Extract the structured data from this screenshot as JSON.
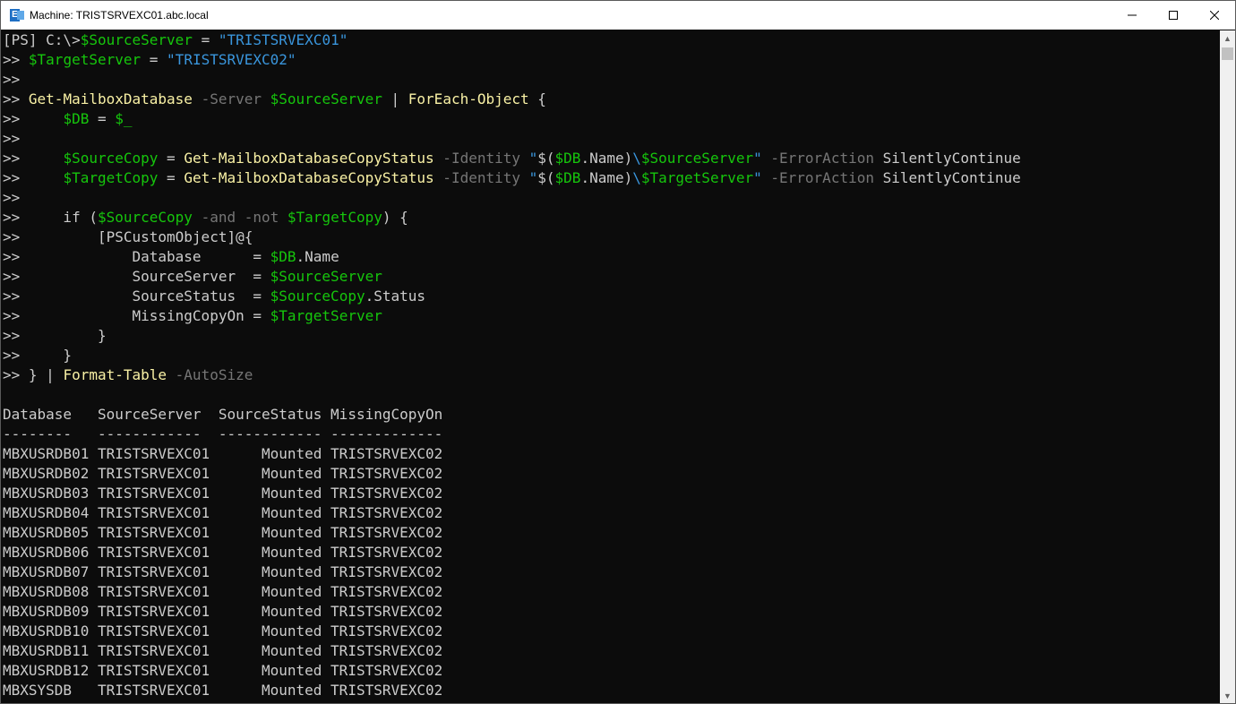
{
  "window": {
    "title": "Machine: TRISTSRVEXC01.abc.local",
    "icon": "exchange-management-shell-icon",
    "controls": [
      "minimize-icon",
      "maximize-icon",
      "close-icon"
    ]
  },
  "colors": {
    "background": "#0c0c0c",
    "default_text": "#cccccc",
    "command": "#f9f1a5",
    "variable": "#16c60c",
    "string": "#3a96dd",
    "parameter": "#767676"
  },
  "console": {
    "lines": [
      [
        {
          "t": "[PS] C:\\>",
          "c": "c-plain"
        },
        {
          "t": "$SourceServer",
          "c": "c-var"
        },
        {
          "t": " = ",
          "c": "c-plain"
        },
        {
          "t": "\"TRISTSRVEXC01\"",
          "c": "c-str"
        }
      ],
      [
        {
          "t": ">> ",
          "c": "c-plain"
        },
        {
          "t": "$TargetServer",
          "c": "c-var"
        },
        {
          "t": " = ",
          "c": "c-plain"
        },
        {
          "t": "\"TRISTSRVEXC02\"",
          "c": "c-str"
        }
      ],
      [
        {
          "t": ">>",
          "c": "c-plain"
        }
      ],
      [
        {
          "t": ">> ",
          "c": "c-plain"
        },
        {
          "t": "Get-MailboxDatabase",
          "c": "c-cmd"
        },
        {
          "t": " -Server",
          "c": "c-param"
        },
        {
          "t": " ",
          "c": "c-plain"
        },
        {
          "t": "$SourceServer",
          "c": "c-var"
        },
        {
          "t": " | ",
          "c": "c-plain"
        },
        {
          "t": "ForEach-Object",
          "c": "c-cmd"
        },
        {
          "t": " {",
          "c": "c-plain"
        }
      ],
      [
        {
          "t": ">>     ",
          "c": "c-plain"
        },
        {
          "t": "$DB",
          "c": "c-var"
        },
        {
          "t": " = ",
          "c": "c-plain"
        },
        {
          "t": "$_",
          "c": "c-var"
        }
      ],
      [
        {
          "t": ">>",
          "c": "c-plain"
        }
      ],
      [
        {
          "t": ">>     ",
          "c": "c-plain"
        },
        {
          "t": "$SourceCopy",
          "c": "c-var"
        },
        {
          "t": " = ",
          "c": "c-plain"
        },
        {
          "t": "Get-MailboxDatabaseCopyStatus",
          "c": "c-cmd"
        },
        {
          "t": " -Identity",
          "c": "c-param"
        },
        {
          "t": " \"",
          "c": "c-str"
        },
        {
          "t": "$(",
          "c": "c-plain"
        },
        {
          "t": "$DB",
          "c": "c-var"
        },
        {
          "t": ".Name)",
          "c": "c-plain"
        },
        {
          "t": "\\",
          "c": "c-str"
        },
        {
          "t": "$SourceServer",
          "c": "c-var"
        },
        {
          "t": "\"",
          "c": "c-str"
        },
        {
          "t": " -ErrorAction",
          "c": "c-param"
        },
        {
          "t": " SilentlyContinue",
          "c": "c-plain"
        }
      ],
      [
        {
          "t": ">>     ",
          "c": "c-plain"
        },
        {
          "t": "$TargetCopy",
          "c": "c-var"
        },
        {
          "t": " = ",
          "c": "c-plain"
        },
        {
          "t": "Get-MailboxDatabaseCopyStatus",
          "c": "c-cmd"
        },
        {
          "t": " -Identity",
          "c": "c-param"
        },
        {
          "t": " \"",
          "c": "c-str"
        },
        {
          "t": "$(",
          "c": "c-plain"
        },
        {
          "t": "$DB",
          "c": "c-var"
        },
        {
          "t": ".Name)",
          "c": "c-plain"
        },
        {
          "t": "\\",
          "c": "c-str"
        },
        {
          "t": "$TargetServer",
          "c": "c-var"
        },
        {
          "t": "\"",
          "c": "c-str"
        },
        {
          "t": " -ErrorAction",
          "c": "c-param"
        },
        {
          "t": " SilentlyContinue",
          "c": "c-plain"
        }
      ],
      [
        {
          "t": ">>",
          "c": "c-plain"
        }
      ],
      [
        {
          "t": ">>     if (",
          "c": "c-plain"
        },
        {
          "t": "$SourceCopy",
          "c": "c-var"
        },
        {
          "t": " -and -not",
          "c": "c-param"
        },
        {
          "t": " ",
          "c": "c-plain"
        },
        {
          "t": "$TargetCopy",
          "c": "c-var"
        },
        {
          "t": ") {",
          "c": "c-plain"
        }
      ],
      [
        {
          "t": ">>         [PSCustomObject]@{",
          "c": "c-plain"
        }
      ],
      [
        {
          "t": ">>             Database      = ",
          "c": "c-plain"
        },
        {
          "t": "$DB",
          "c": "c-var"
        },
        {
          "t": ".Name",
          "c": "c-plain"
        }
      ],
      [
        {
          "t": ">>             SourceServer  = ",
          "c": "c-plain"
        },
        {
          "t": "$SourceServer",
          "c": "c-var"
        }
      ],
      [
        {
          "t": ">>             SourceStatus  = ",
          "c": "c-plain"
        },
        {
          "t": "$SourceCopy",
          "c": "c-var"
        },
        {
          "t": ".Status",
          "c": "c-plain"
        }
      ],
      [
        {
          "t": ">>             MissingCopyOn = ",
          "c": "c-plain"
        },
        {
          "t": "$TargetServer",
          "c": "c-var"
        }
      ],
      [
        {
          "t": ">>         }",
          "c": "c-plain"
        }
      ],
      [
        {
          "t": ">>     }",
          "c": "c-plain"
        }
      ],
      [
        {
          "t": ">> } | ",
          "c": "c-plain"
        },
        {
          "t": "Format-Table",
          "c": "c-cmd"
        },
        {
          "t": " -AutoSize",
          "c": "c-param"
        }
      ],
      [
        {
          "t": "",
          "c": "c-plain"
        }
      ],
      [
        {
          "t": "Database   SourceServer  SourceStatus MissingCopyOn",
          "c": "c-plain"
        }
      ],
      [
        {
          "t": "--------   ------------  ------------ -------------",
          "c": "c-plain"
        }
      ],
      [
        {
          "t": "MBXUSRDB01 TRISTSRVEXC01      Mounted TRISTSRVEXC02",
          "c": "c-plain"
        }
      ],
      [
        {
          "t": "MBXUSRDB02 TRISTSRVEXC01      Mounted TRISTSRVEXC02",
          "c": "c-plain"
        }
      ],
      [
        {
          "t": "MBXUSRDB03 TRISTSRVEXC01      Mounted TRISTSRVEXC02",
          "c": "c-plain"
        }
      ],
      [
        {
          "t": "MBXUSRDB04 TRISTSRVEXC01      Mounted TRISTSRVEXC02",
          "c": "c-plain"
        }
      ],
      [
        {
          "t": "MBXUSRDB05 TRISTSRVEXC01      Mounted TRISTSRVEXC02",
          "c": "c-plain"
        }
      ],
      [
        {
          "t": "MBXUSRDB06 TRISTSRVEXC01      Mounted TRISTSRVEXC02",
          "c": "c-plain"
        }
      ],
      [
        {
          "t": "MBXUSRDB07 TRISTSRVEXC01      Mounted TRISTSRVEXC02",
          "c": "c-plain"
        }
      ],
      [
        {
          "t": "MBXUSRDB08 TRISTSRVEXC01      Mounted TRISTSRVEXC02",
          "c": "c-plain"
        }
      ],
      [
        {
          "t": "MBXUSRDB09 TRISTSRVEXC01      Mounted TRISTSRVEXC02",
          "c": "c-plain"
        }
      ],
      [
        {
          "t": "MBXUSRDB10 TRISTSRVEXC01      Mounted TRISTSRVEXC02",
          "c": "c-plain"
        }
      ],
      [
        {
          "t": "MBXUSRDB11 TRISTSRVEXC01      Mounted TRISTSRVEXC02",
          "c": "c-plain"
        }
      ],
      [
        {
          "t": "MBXUSRDB12 TRISTSRVEXC01      Mounted TRISTSRVEXC02",
          "c": "c-plain"
        }
      ],
      [
        {
          "t": "MBXSYSDB   TRISTSRVEXC01      Mounted TRISTSRVEXC02",
          "c": "c-plain"
        }
      ]
    ]
  }
}
